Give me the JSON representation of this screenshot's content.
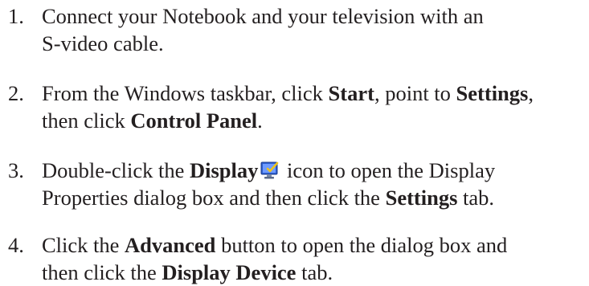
{
  "steps": [
    {
      "number": "1.",
      "line1": "Connect your Notebook and your television with an",
      "line2": "S-video cable."
    },
    {
      "number": "2.",
      "line1_a": "From the Windows taskbar, click ",
      "line1_b": "Start",
      "line1_c": ", point to ",
      "line1_d": "Settings",
      "line1_e": ",",
      "line2_a": "then click ",
      "line2_b": "Control Panel",
      "line2_c": "."
    },
    {
      "number": "3.",
      "line1_a": "Double-click the ",
      "line1_b": "Display",
      "icon": "display-properties-icon",
      "line1_c": " icon to open the Display",
      "line2_a": "Properties dialog box and then click the ",
      "line2_b": "Settings",
      "line2_c": " tab."
    },
    {
      "number": "4.",
      "line1_a": "Click the ",
      "line1_b": "Advanced",
      "line1_c": " button to open the dialog box and",
      "line2_a": "then click the ",
      "line2_b": "Display Device",
      "line2_c": " tab."
    }
  ],
  "colors": {
    "text": "#231f20",
    "icon_monitor": "#2e5fd0",
    "icon_check": "#f0c419"
  }
}
